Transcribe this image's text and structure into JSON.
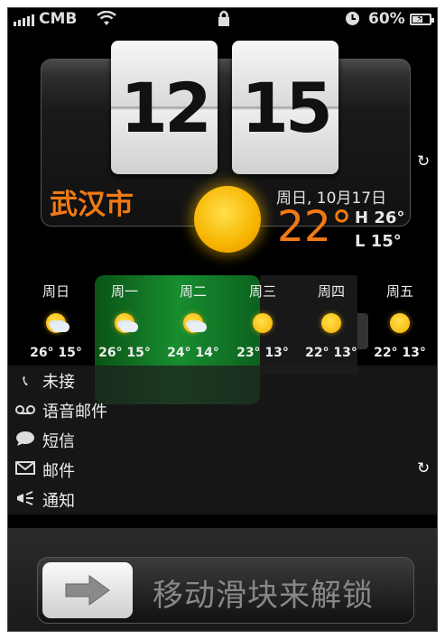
{
  "status_bar": {
    "carrier": "CMB",
    "battery": "60%",
    "battery_level": 0.6
  },
  "widget": {
    "hour": "12",
    "minute": "15",
    "city": "武汉市",
    "date": "周日, 10月17日",
    "temperature": "22°",
    "high": "H 26°",
    "low": "L 15°"
  },
  "forecast": [
    {
      "day": "周日",
      "temps": "26° 15°",
      "icon": "partly-cloudy-icon"
    },
    {
      "day": "周一",
      "temps": "26° 15°",
      "icon": "partly-cloudy-icon"
    },
    {
      "day": "周二",
      "temps": "24° 14°",
      "icon": "partly-cloudy-icon"
    },
    {
      "day": "周三",
      "temps": "23° 13°",
      "icon": "sunny-icon"
    },
    {
      "day": "周四",
      "temps": "22° 13°",
      "icon": "sunny-icon"
    },
    {
      "day": "周五",
      "temps": "22° 13°",
      "icon": "sunny-icon"
    }
  ],
  "notifications": [
    {
      "label": "未接",
      "icon": "phone-icon"
    },
    {
      "label": "语音邮件",
      "icon": "voicemail-icon"
    },
    {
      "label": "短信",
      "icon": "speech-bubble-icon"
    },
    {
      "label": "邮件",
      "icon": "envelope-icon"
    },
    {
      "label": "通知",
      "icon": "megaphone-icon"
    }
  ],
  "slider": {
    "text": "移动滑块来解锁"
  }
}
